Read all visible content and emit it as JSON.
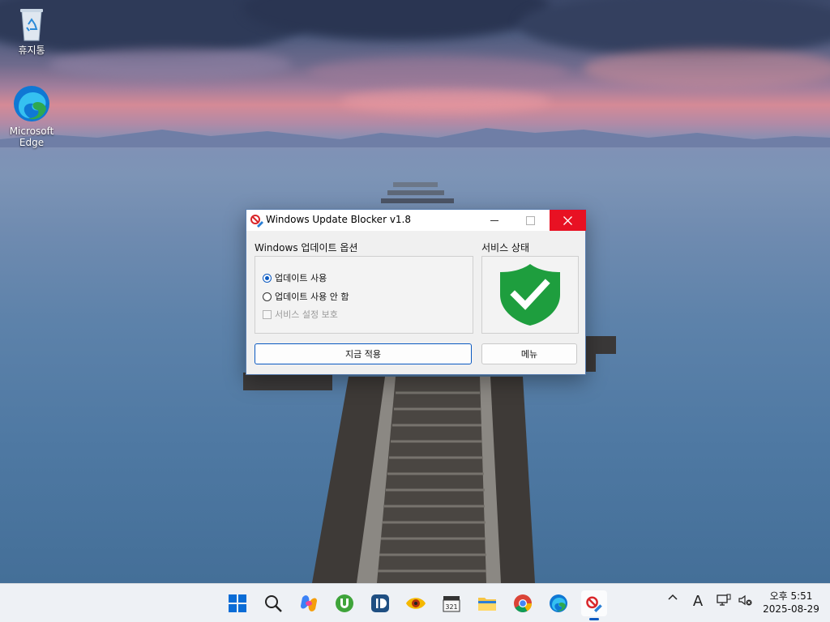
{
  "desktop": {
    "icons": [
      {
        "label": "휴지통"
      },
      {
        "label": "Microsoft Edge"
      }
    ]
  },
  "dialog": {
    "title": "Windows Update Blocker v1.8",
    "options_group_label": "Windows 업데이트 옵션",
    "status_group_label": "서비스 상태",
    "options": [
      {
        "label": "업데이트 사용",
        "selected": true
      },
      {
        "label": "업데이트 사용 안 함",
        "selected": false
      }
    ],
    "protect_label": "서비스 설정 보호",
    "apply_label": "지금 적용",
    "menu_label": "메뉴",
    "status_icon": "green-shield-check-icon"
  },
  "taskbar": {
    "clock_time": "오후 5:51",
    "clock_date": "2025-08-29",
    "ime_label": "A"
  },
  "colors": {
    "accent": "#0a59c1",
    "close": "#e81123",
    "shield": "#1e9e3e"
  }
}
